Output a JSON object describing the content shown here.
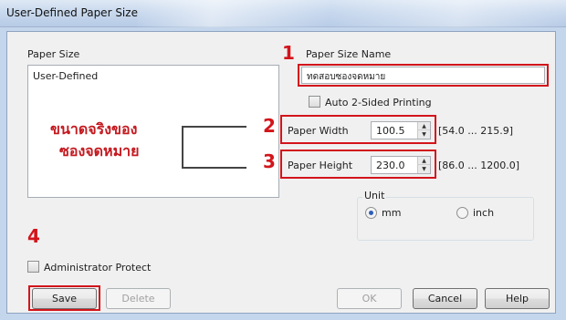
{
  "window": {
    "title": "User-Defined Paper Size"
  },
  "paper_size": {
    "label": "Paper Size",
    "items": [
      "User-Defined"
    ]
  },
  "annotations": {
    "note_line1": "ขนาดจริงของ",
    "note_line2": "ซองจดหมาย",
    "step1": "1",
    "step2": "2",
    "step3": "3",
    "step4": "4",
    "accent_color": "#d2151b"
  },
  "paper_size_name": {
    "label": "Paper Size Name",
    "value": "ทดสอบซองจดหมาย"
  },
  "auto_2sided": {
    "label": "Auto 2-Sided Printing",
    "checked": false
  },
  "paper_width": {
    "label": "Paper Width",
    "value": "100.5",
    "range": "[54.0 ... 215.9]"
  },
  "paper_height": {
    "label": "Paper Height",
    "value": "230.0",
    "range": "[86.0 ... 1200.0]"
  },
  "unit": {
    "label": "Unit",
    "options": [
      "mm",
      "inch"
    ],
    "selected": "mm"
  },
  "admin_protect": {
    "label": "Administrator Protect",
    "checked": false
  },
  "buttons": {
    "save": "Save",
    "delete": "Delete",
    "ok": "OK",
    "cancel": "Cancel",
    "help": "Help"
  }
}
